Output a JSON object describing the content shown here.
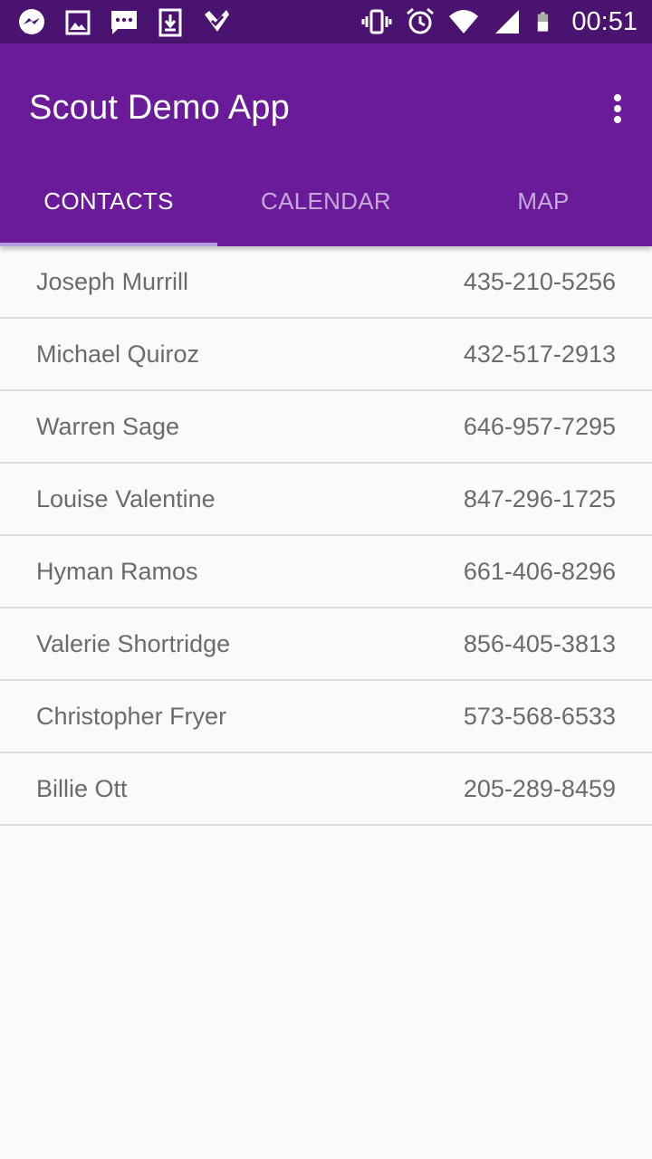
{
  "status_bar": {
    "left_icons": [
      "messenger-icon",
      "image-icon",
      "sms-icon",
      "download-icon",
      "check-icon"
    ],
    "right_icons": [
      "vibrate-icon",
      "alarm-icon",
      "wifi-icon",
      "signal-icon",
      "battery-icon"
    ],
    "time": "00:51"
  },
  "app_bar": {
    "title": "Scout Demo App",
    "menu_icon": "overflow-menu-icon",
    "color": "#6a1b9a",
    "status_color": "#4a136f"
  },
  "tabs": [
    {
      "label": "CONTACTS",
      "active": true
    },
    {
      "label": "CALENDAR",
      "active": false
    },
    {
      "label": "MAP",
      "active": false
    }
  ],
  "contacts": [
    {
      "name": "Joseph Murrill",
      "phone": "435-210-5256"
    },
    {
      "name": "Michael Quiroz",
      "phone": "432-517-2913"
    },
    {
      "name": "Warren Sage",
      "phone": "646-957-7295"
    },
    {
      "name": "Louise Valentine",
      "phone": "847-296-1725"
    },
    {
      "name": "Hyman Ramos",
      "phone": "661-406-8296"
    },
    {
      "name": "Valerie Shortridge",
      "phone": "856-405-3813"
    },
    {
      "name": "Christopher Fryer",
      "phone": "573-568-6533"
    },
    {
      "name": "Billie Ott",
      "phone": "205-289-8459"
    }
  ]
}
